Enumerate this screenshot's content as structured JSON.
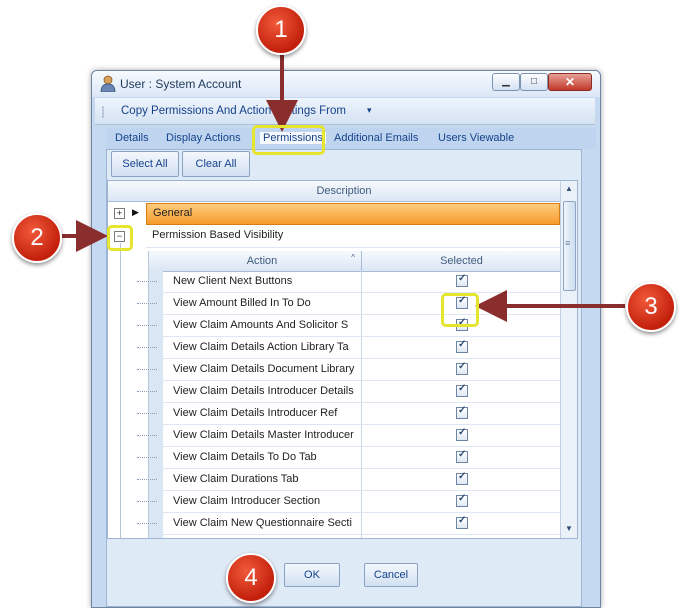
{
  "window": {
    "title": "User : System Account",
    "controls": {
      "minimize": "▁",
      "maximize": "□",
      "close": "✕"
    }
  },
  "toolbar": {
    "copy_label": "Copy Permissions And Action Settings From",
    "copy_caret": "▾"
  },
  "tabs": [
    "Details",
    "Display Actions",
    "Permissions",
    "Additional Emails",
    "Users Viewable"
  ],
  "active_tab": "Permissions",
  "buttons": {
    "select_all": "Select All",
    "clear_all": "Clear All",
    "ok": "OK",
    "cancel": "Cancel"
  },
  "grid": {
    "header": "Description",
    "groups": [
      {
        "expander": "+",
        "label": "General",
        "selected": true
      },
      {
        "expander": "−",
        "label": "Permission Based Visibility",
        "selected": false
      }
    ],
    "sub_headers": {
      "action": "Action",
      "selected": "Selected",
      "sort_glyph": "^"
    },
    "rows": [
      {
        "action": "New Client Next Buttons",
        "checked": true
      },
      {
        "action": "View Amount Billed In To Do",
        "checked": true
      },
      {
        "action": "View Claim Amounts And Solicitor S",
        "checked": true
      },
      {
        "action": "View Claim Details Action Library Ta",
        "checked": true
      },
      {
        "action": "View Claim Details Document Library",
        "checked": true
      },
      {
        "action": "View Claim Details Introducer Details",
        "checked": true
      },
      {
        "action": "View Claim Details Introducer Ref",
        "checked": true
      },
      {
        "action": "View Claim Details Master Introducer",
        "checked": true
      },
      {
        "action": "View Claim Details To Do Tab",
        "checked": true
      },
      {
        "action": "View Claim Durations Tab",
        "checked": true
      },
      {
        "action": "View Claim Introducer Section",
        "checked": true
      },
      {
        "action": "View Claim New Questionnaire Secti",
        "checked": true
      }
    ]
  },
  "callouts": [
    "1",
    "2",
    "3",
    "4"
  ],
  "colors": {
    "accent": "#15428b",
    "highlight": "#e5e52e",
    "callout": "#d0301a",
    "arrow": "#8a2d2d",
    "general_row": "#f7a13a"
  },
  "icons": {
    "scroll_up": "▲",
    "scroll_down": "▼",
    "scroll_grip": "≡",
    "row_pointer": "▶"
  }
}
